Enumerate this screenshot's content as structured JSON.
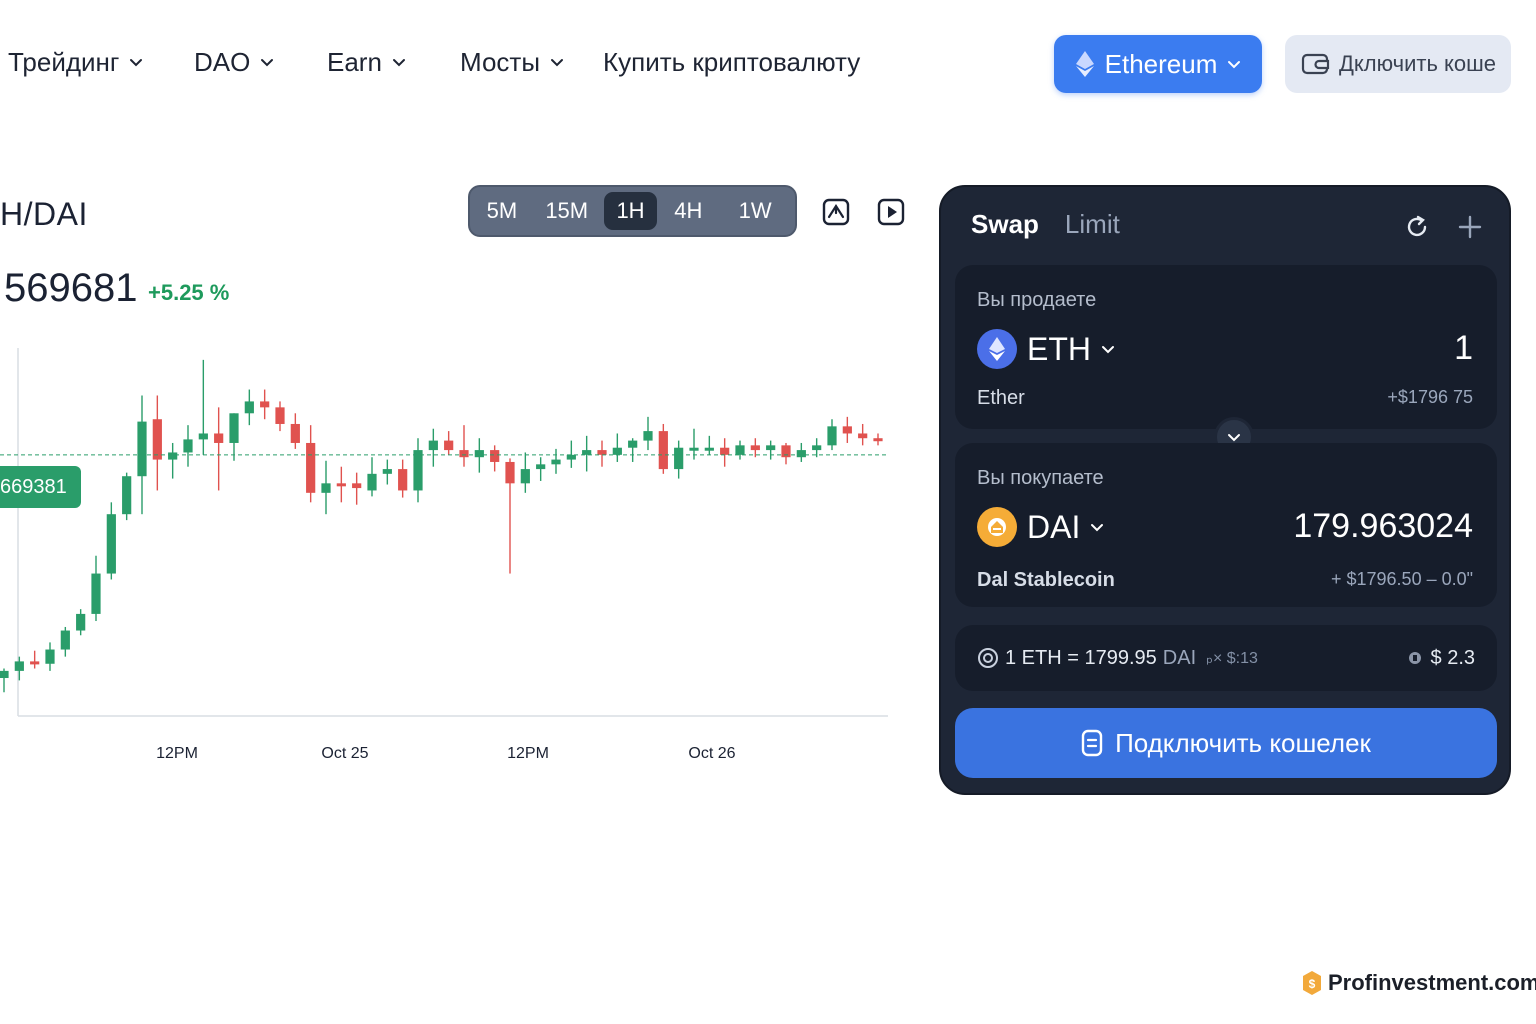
{
  "nav": {
    "items": [
      {
        "label": "Трейдинг",
        "has_dropdown": true
      },
      {
        "label": "DAO",
        "has_dropdown": true
      },
      {
        "label": "Earn",
        "has_dropdown": true
      },
      {
        "label": "Мосты",
        "has_dropdown": true
      },
      {
        "label": "Купить криптовалюту",
        "has_dropdown": false
      }
    ],
    "network_button": {
      "label": "Ethereum",
      "icon": "ethereum-icon"
    },
    "wallet_button": {
      "label": "Дключить коше",
      "icon": "wallet-icon"
    }
  },
  "chart_header": {
    "pair": "TH/DAI",
    "price": "569681",
    "change": "+5.25 %",
    "timeframes": [
      "5M",
      "15M",
      "1H",
      "4H",
      "1W"
    ],
    "active_timeframe": "1H"
  },
  "chart_data": {
    "type": "candlestick",
    "x_tick_labels": [
      "12PM",
      "Oct 25",
      "12PM",
      "Oct 26"
    ],
    "current_price_label": "669381",
    "colors": {
      "up": "#2a9d6a",
      "down": "#e0524f",
      "current_line": "#2a9d6a"
    },
    "candles": [
      {
        "o": 12,
        "h": 20,
        "l": 0,
        "c": 18
      },
      {
        "o": 18,
        "h": 30,
        "l": 10,
        "c": 26
      },
      {
        "o": 26,
        "h": 35,
        "l": 20,
        "c": 24
      },
      {
        "o": 24,
        "h": 42,
        "l": 18,
        "c": 36
      },
      {
        "o": 36,
        "h": 55,
        "l": 30,
        "c": 52
      },
      {
        "o": 52,
        "h": 70,
        "l": 48,
        "c": 66
      },
      {
        "o": 66,
        "h": 115,
        "l": 60,
        "c": 100
      },
      {
        "o": 100,
        "h": 160,
        "l": 95,
        "c": 150
      },
      {
        "o": 150,
        "h": 185,
        "l": 145,
        "c": 182
      },
      {
        "o": 182,
        "h": 250,
        "l": 150,
        "c": 228
      },
      {
        "o": 230,
        "h": 250,
        "l": 170,
        "c": 196
      },
      {
        "o": 196,
        "h": 210,
        "l": 180,
        "c": 202
      },
      {
        "o": 202,
        "h": 225,
        "l": 190,
        "c": 213
      },
      {
        "o": 213,
        "h": 280,
        "l": 200,
        "c": 218
      },
      {
        "o": 218,
        "h": 240,
        "l": 170,
        "c": 210
      },
      {
        "o": 210,
        "h": 235,
        "l": 195,
        "c": 235
      },
      {
        "o": 235,
        "h": 255,
        "l": 225,
        "c": 245
      },
      {
        "o": 245,
        "h": 255,
        "l": 230,
        "c": 240
      },
      {
        "o": 240,
        "h": 245,
        "l": 220,
        "c": 226
      },
      {
        "o": 226,
        "h": 235,
        "l": 205,
        "c": 210
      },
      {
        "o": 210,
        "h": 225,
        "l": 160,
        "c": 168
      },
      {
        "o": 168,
        "h": 195,
        "l": 150,
        "c": 176
      },
      {
        "o": 176,
        "h": 190,
        "l": 160,
        "c": 174
      },
      {
        "o": 176,
        "h": 185,
        "l": 158,
        "c": 172
      },
      {
        "o": 170,
        "h": 198,
        "l": 165,
        "c": 184
      },
      {
        "o": 184,
        "h": 196,
        "l": 175,
        "c": 188
      },
      {
        "o": 188,
        "h": 196,
        "l": 164,
        "c": 170
      },
      {
        "o": 170,
        "h": 214,
        "l": 160,
        "c": 204
      },
      {
        "o": 204,
        "h": 222,
        "l": 190,
        "c": 212
      },
      {
        "o": 212,
        "h": 220,
        "l": 200,
        "c": 204
      },
      {
        "o": 204,
        "h": 225,
        "l": 190,
        "c": 198
      },
      {
        "o": 198,
        "h": 214,
        "l": 185,
        "c": 204
      },
      {
        "o": 204,
        "h": 208,
        "l": 186,
        "c": 194
      },
      {
        "o": 194,
        "h": 197,
        "l": 100,
        "c": 176
      },
      {
        "o": 176,
        "h": 202,
        "l": 168,
        "c": 188
      },
      {
        "o": 188,
        "h": 198,
        "l": 178,
        "c": 192
      },
      {
        "o": 192,
        "h": 205,
        "l": 184,
        "c": 196
      },
      {
        "o": 196,
        "h": 212,
        "l": 189,
        "c": 200
      },
      {
        "o": 200,
        "h": 216,
        "l": 186,
        "c": 204
      },
      {
        "o": 204,
        "h": 212,
        "l": 190,
        "c": 200
      },
      {
        "o": 200,
        "h": 218,
        "l": 194,
        "c": 206
      },
      {
        "o": 206,
        "h": 214,
        "l": 194,
        "c": 212
      },
      {
        "o": 212,
        "h": 232,
        "l": 204,
        "c": 220
      },
      {
        "o": 220,
        "h": 226,
        "l": 184,
        "c": 188
      },
      {
        "o": 188,
        "h": 212,
        "l": 180,
        "c": 206
      },
      {
        "o": 204,
        "h": 222,
        "l": 196,
        "c": 206
      },
      {
        "o": 206,
        "h": 216,
        "l": 200,
        "c": 206
      },
      {
        "o": 206,
        "h": 214,
        "l": 190,
        "c": 200
      },
      {
        "o": 200,
        "h": 212,
        "l": 196,
        "c": 208
      },
      {
        "o": 208,
        "h": 214,
        "l": 198,
        "c": 204
      },
      {
        "o": 204,
        "h": 212,
        "l": 196,
        "c": 208
      },
      {
        "o": 208,
        "h": 210,
        "l": 192,
        "c": 198
      },
      {
        "o": 198,
        "h": 210,
        "l": 194,
        "c": 204
      },
      {
        "o": 204,
        "h": 214,
        "l": 198,
        "c": 208
      },
      {
        "o": 208,
        "h": 230,
        "l": 204,
        "c": 224
      },
      {
        "o": 224,
        "h": 232,
        "l": 210,
        "c": 218
      },
      {
        "o": 218,
        "h": 226,
        "l": 208,
        "c": 214
      },
      {
        "o": 214,
        "h": 218,
        "l": 208,
        "c": 212
      }
    ],
    "current_price_level": 200,
    "ylim": [
      -20,
      290
    ]
  },
  "swap": {
    "tabs": [
      "Swap",
      "Limit"
    ],
    "active_tab": "Swap",
    "sell": {
      "label": "Вы продаете",
      "token": "ETH",
      "token_name": "Ether",
      "amount": "1",
      "usd": "+$1796 75"
    },
    "buy": {
      "label": "Вы покупаете",
      "token": "DAI",
      "token_name": "Dal Stablecoin",
      "amount": "179.963024",
      "usd": "+ $1796.50 – 0.0\""
    },
    "rate": {
      "text": "1 ETH = 1799.95",
      "unit": "DAI",
      "extra": "ₚ× $:13",
      "fee": "$ 2.3"
    },
    "connect_label": "Подключить кошелек"
  },
  "watermark": "Profinvestment.com"
}
